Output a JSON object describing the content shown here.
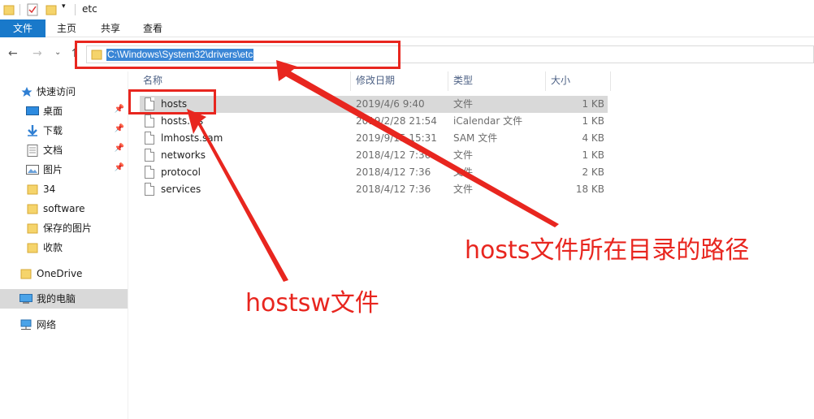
{
  "window": {
    "title": "etc"
  },
  "ribbon": {
    "tabs": [
      "文件",
      "主页",
      "共享",
      "查看"
    ]
  },
  "address": {
    "path": "C:\\Windows\\System32\\drivers\\etc"
  },
  "sidebar": {
    "items": [
      {
        "label": "快速访问",
        "icon": "star-icon",
        "pinned": false
      },
      {
        "label": "桌面",
        "icon": "desktop-icon",
        "pinned": true
      },
      {
        "label": "下载",
        "icon": "download-icon",
        "pinned": true
      },
      {
        "label": "文档",
        "icon": "document-icon",
        "pinned": true
      },
      {
        "label": "图片",
        "icon": "picture-icon",
        "pinned": true
      },
      {
        "label": "34",
        "icon": "folder-icon",
        "pinned": false
      },
      {
        "label": "software",
        "icon": "folder-icon",
        "pinned": false
      },
      {
        "label": "保存的图片",
        "icon": "folder-icon",
        "pinned": false
      },
      {
        "label": "收款",
        "icon": "folder-icon",
        "pinned": false
      },
      {
        "label": "OneDrive",
        "icon": "onedrive-folder-icon",
        "pinned": false
      },
      {
        "label": "我的电脑",
        "icon": "computer-icon",
        "pinned": false,
        "selected": true
      },
      {
        "label": "网络",
        "icon": "network-icon",
        "pinned": false
      }
    ]
  },
  "columns": {
    "name": "名称",
    "modified": "修改日期",
    "type": "类型",
    "size": "大小"
  },
  "files": [
    {
      "name": "hosts",
      "modified": "2019/4/6 9:40",
      "type": "文件",
      "size": "1 KB",
      "selected": true
    },
    {
      "name": "hosts.ics",
      "modified": "2019/2/28 21:54",
      "type": "iCalendar 文件",
      "size": "1 KB"
    },
    {
      "name": "lmhosts.sam",
      "modified": "2019/9/15 15:31",
      "type": "SAM 文件",
      "size": "4 KB"
    },
    {
      "name": "networks",
      "modified": "2018/4/12 7:36",
      "type": "文件",
      "size": "1 KB"
    },
    {
      "name": "protocol",
      "modified": "2018/4/12 7:36",
      "type": "文件",
      "size": "2 KB"
    },
    {
      "name": "services",
      "modified": "2018/4/12 7:36",
      "type": "文件",
      "size": "18 KB"
    }
  ],
  "annotations": {
    "path_note": "hosts文件所在目录的路径",
    "file_note": "hostsw文件",
    "color": "#e8261f"
  }
}
